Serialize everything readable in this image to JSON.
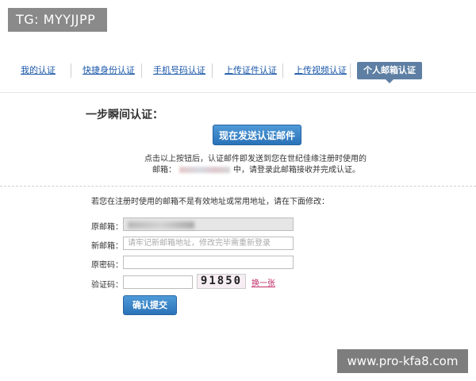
{
  "watermarks": {
    "top_left": "TG: MYYJJPP",
    "bottom_right": "www.pro-kfa8.com"
  },
  "tabs": [
    {
      "label": "我的认证",
      "active": false
    },
    {
      "label": "快捷身份认证",
      "active": false
    },
    {
      "label": "手机号码认证",
      "active": false
    },
    {
      "label": "上传证件认证",
      "active": false
    },
    {
      "label": "上传视频认证",
      "active": false
    },
    {
      "label": "个人邮箱认证",
      "active": true
    }
  ],
  "main": {
    "title": "一步瞬间认证：",
    "send_button": "现在发送认证邮件",
    "info_line1": "点击以上按钮后，认证邮件即发送到您在世纪佳缘注册时使用的",
    "info_line2_prefix": "邮箱：",
    "info_line2_suffix": "中，请登录此邮箱接收并完成认证。"
  },
  "form": {
    "note": "若您在注册时使用的邮箱不是有效地址或常用地址，请在下面修改：",
    "original_email_label": "原邮箱：",
    "new_email_label": "新邮箱：",
    "new_email_placeholder": "请牢记新邮箱地址，修改完毕需重新登录",
    "password_label": "原密码：",
    "captcha_label": "验证码：",
    "captcha_text": "91850",
    "refresh_label": "换一张",
    "submit_label": "确认提交"
  },
  "colors": {
    "link": "#1a57a8",
    "button": "#2a72b8",
    "active_tab": "#5e7fa3",
    "refresh": "#c0306a"
  }
}
